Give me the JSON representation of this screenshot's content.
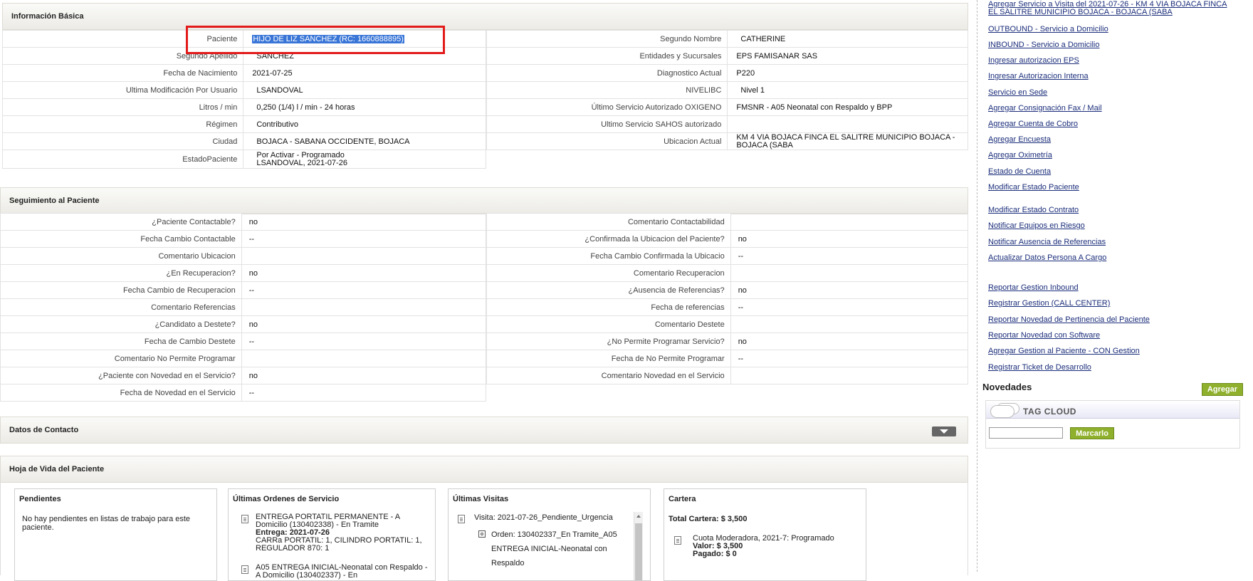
{
  "basic": {
    "title": "Información Básica",
    "left": [
      {
        "label": "Paciente",
        "value": "HIJO DE LIZ SANCHEZ (RC: 1660888895)"
      },
      {
        "label": "Segundo Apellido",
        "value": "SANCHEZ"
      },
      {
        "label": "Fecha de Nacimiento",
        "value": "2021-07-25"
      },
      {
        "label": "Ultima Modificación Por Usuario",
        "value": "LSANDOVAL"
      },
      {
        "label": "Litros / min",
        "value": "0,250 (1/4) l / min - 24 horas"
      },
      {
        "label": "Régimen",
        "value": "Contributivo"
      },
      {
        "label": "Ciudad",
        "value": "BOJACA - SABANA OCCIDENTE, BOJACA"
      },
      {
        "label": "EstadoPaciente",
        "value": "Por Activar - Programado",
        "value2": "LSANDOVAL, 2021-07-26"
      }
    ],
    "right": [
      {
        "label": "Segundo Nombre",
        "value": "CATHERINE"
      },
      {
        "label": "Entidades y Sucursales",
        "value": "EPS FAMISANAR SAS"
      },
      {
        "label": "Diagnostico Actual",
        "value": "P220"
      },
      {
        "label": "NIVELIBC",
        "value": "Nivel 1"
      },
      {
        "label": "Último Servicio Autorizado OXIGENO",
        "value": "FMSNR - A05 Neonatal con Respaldo y BPP"
      },
      {
        "label": "Ultimo Servicio SAHOS autorizado",
        "value": ""
      },
      {
        "label": "Ubicacion Actual",
        "value": "KM 4 VIA BOJACA FINCA EL SALITRE MUNICIPIO BOJACA - BOJACA (SABA"
      }
    ]
  },
  "seguimiento": {
    "title": "Seguimiento al Paciente",
    "left": [
      {
        "label": "¿Paciente Contactable?",
        "value": "no"
      },
      {
        "label": "Fecha Cambio Contactable",
        "value": "--"
      },
      {
        "label": "Comentario Ubicacion",
        "value": ""
      },
      {
        "label": "¿En Recuperacion?",
        "value": "no"
      },
      {
        "label": "Fecha Cambio de Recuperacion",
        "value": "--"
      },
      {
        "label": "Comentario Referencias",
        "value": ""
      },
      {
        "label": "¿Candidato a Destete?",
        "value": "no"
      },
      {
        "label": "Fecha de Cambio Destete",
        "value": "--"
      },
      {
        "label": "Comentario No Permite Programar",
        "value": ""
      },
      {
        "label": "¿Paciente con Novedad en el Servicio?",
        "value": "no"
      },
      {
        "label": "Fecha de Novedad en el Servicio",
        "value": "--"
      }
    ],
    "right": [
      {
        "label": "Comentario Contactabilidad",
        "value": ""
      },
      {
        "label": "¿Confirmada la Ubicacion del Paciente?",
        "value": "no"
      },
      {
        "label": "Fecha Cambio Confirmada la Ubicacio",
        "value": "--"
      },
      {
        "label": "Comentario Recuperacion",
        "value": ""
      },
      {
        "label": "¿Ausencia de Referencias?",
        "value": "no"
      },
      {
        "label": "Fecha de referencias",
        "value": "--"
      },
      {
        "label": "Comentario Destete",
        "value": ""
      },
      {
        "label": "¿No Permite Programar Servicio?",
        "value": "no"
      },
      {
        "label": "Fecha de No Permite Programar",
        "value": "--"
      },
      {
        "label": "Comentario Novedad en el Servicio",
        "value": ""
      }
    ]
  },
  "contacto": {
    "title": "Datos de Contacto"
  },
  "hoja": {
    "title": "Hoja de Vida del Paciente",
    "pendientes": {
      "title": "Pendientes",
      "text": "No hay pendientes en listas de trabajo para este paciente."
    },
    "ordenes": {
      "title": "Últimas Ordenes de Servicio",
      "o1_text": "ENTREGA PORTATIL PERMANENTE - A Domicilio (130402338) - En Tramite",
      "o1_entrega_label": "Entrega:",
      "o1_entrega": "2021-07-26",
      "o1_detail": "CARRa PORTATIL: 1, CILINDRO PORTATIL: 1, REGULADOR 870: 1",
      "o2_text": "A05 ENTREGA INICIAL-Neonatal con Respaldo - A Domicilio (130402337) - En"
    },
    "visitas": {
      "title": "Últimas Visitas",
      "visita": "Visita: 2021-07-26_Pendiente_Urgencia",
      "orden": "Orden: 130402337_En Tramite_A05 ENTREGA INICIAL-Neonatal con Respaldo"
    },
    "cartera": {
      "title": "Cartera",
      "total": "Total Cartera: $ 3,500",
      "cuota": "Cuota Moderadora, 2021-7: Programado",
      "valor_label": "Valor:",
      "valor": "$ 3,500",
      "pagado_label": "Pagado:",
      "pagado": "$ 0"
    }
  },
  "sidebar": {
    "links": [
      "Agregar Servicio a Visita del 2021-07-26 - KM 4 VIA BOJACA FINCA",
      "EL SALITRE MUNICIPIO BOJACA - BOJACA (SABA",
      "OUTBOUND - Servicio a Domicilio",
      "INBOUND - Servicio a Domicilio",
      "Ingresar autorizacion EPS",
      "Ingresar Autorizacion Interna",
      "Servicio en Sede",
      "Agregar Consignación Fax / Mail",
      "Agregar Cuenta de Cobro",
      "Agregar Encuesta",
      "Agregar Oximetría",
      "Estado de Cuenta",
      "Modificar Estado Paciente",
      "Modificar Estado Contrato",
      "Notificar Equipos en Riesgo",
      "Notificar Ausencia de Referencias",
      "Actualizar Datos Persona A Cargo",
      "Reportar Gestion Inbound",
      "Registrar Gestion (CALL CENTER)",
      "Reportar Novedad de Pertinencia del Paciente",
      "Reportar Novedad con Software",
      "Agregar Gestion al Paciente - CON Gestion",
      "Registrar Ticket de Desarrollo"
    ],
    "novedades_title": "Novedades",
    "agregar_label": "Agregar",
    "tagcloud_label": "TAG CLOUD",
    "marcarlo_label": "Marcarlo",
    "tag_input_value": ""
  }
}
